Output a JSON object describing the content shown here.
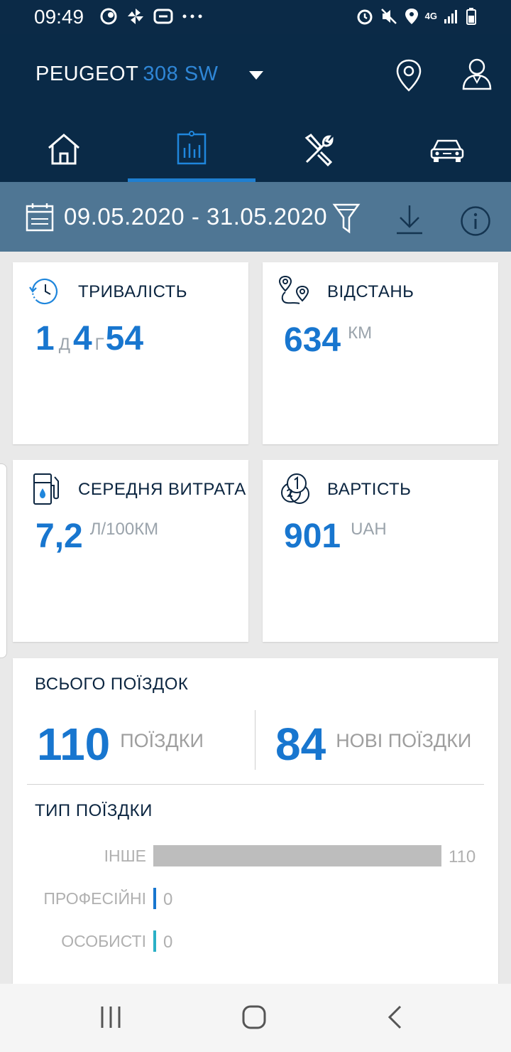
{
  "status_bar": {
    "time": "09:49",
    "network": "4G"
  },
  "header": {
    "brand": "PEUGEOT",
    "model": "308 SW"
  },
  "tabs": [
    {
      "name": "home",
      "icon": "home-icon"
    },
    {
      "name": "statistics",
      "icon": "stats-icon",
      "active": true
    },
    {
      "name": "maintenance",
      "icon": "tools-icon"
    },
    {
      "name": "vehicle",
      "icon": "car-icon"
    }
  ],
  "filter_bar": {
    "date_range": "09.05.2020 - 31.05.2020"
  },
  "cards": {
    "duration": {
      "title": "ТРИВАЛІСТЬ",
      "days": "1",
      "days_unit": "Д",
      "hours": "4",
      "hours_unit": "Г",
      "minutes": "54"
    },
    "distance": {
      "title": "ВІДСТАНЬ",
      "value": "634",
      "unit": "КМ"
    },
    "consumption": {
      "title": "СЕРЕДНЯ ВИТРАТА",
      "value": "7,2",
      "unit": "Л/100КМ"
    },
    "cost": {
      "title": "ВАРТІСТЬ",
      "value": "901",
      "unit": "UAH"
    }
  },
  "trips": {
    "title": "ВСЬОГО ПОЇЗДОК",
    "total_value": "110",
    "total_label": "ПОЇЗДКИ",
    "new_value": "84",
    "new_label": "НОВІ ПОЇЗДКИ",
    "type_title": "ТИП ПОЇЗДКИ"
  },
  "chart_data": {
    "type": "bar",
    "orientation": "horizontal",
    "title": "ТИП ПОЇЗДКИ",
    "categories": [
      "ІНШЕ",
      "ПРОФЕСІЙНІ",
      "ОСОБИСТІ"
    ],
    "values": [
      110,
      0,
      0
    ],
    "value_labels": [
      "110",
      "0",
      "0"
    ],
    "colors": [
      "#bdbdbd",
      "#1876cf",
      "#2ab0c6"
    ],
    "xlim": [
      0,
      110
    ],
    "grid": false
  },
  "colors": {
    "header": "#0a2a47",
    "filter_bar": "#4f7694",
    "accent": "#1876cf",
    "card": "#ffffff",
    "background": "#e9e9e9"
  }
}
